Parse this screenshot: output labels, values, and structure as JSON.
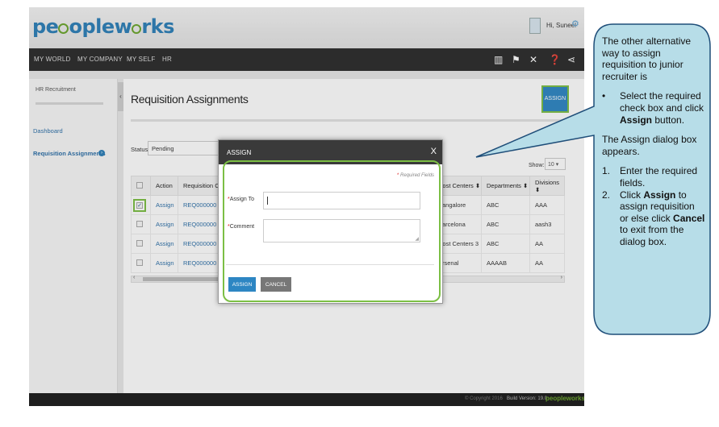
{
  "app": {
    "logo_text_a": "pe",
    "logo_text_b": "oplew",
    "logo_text_c": "rks",
    "greeting": "Hi, Suneel"
  },
  "nav": {
    "items": [
      "MY WORLD",
      "MY COMPANY",
      "MY SELF",
      "HR"
    ],
    "icons": [
      "book-icon",
      "flag-icon",
      "tools-icon",
      "help-icon",
      "share-icon"
    ]
  },
  "sidebar": {
    "section_title": "HR Recruitment",
    "items": [
      "Dashboard",
      "Requisition Assignments"
    ]
  },
  "main": {
    "page_title": "Requisition Assignments",
    "assign_button_top": "ASSIGN",
    "status_label": "Status",
    "status_value": "Pending",
    "show_label": "Show:",
    "show_value": "10",
    "columns": [
      "",
      "Action",
      "Requisition C",
      "Cost Centers",
      "Departments",
      "Divisions"
    ],
    "rows": [
      {
        "checked": true,
        "action": "Assign",
        "req": "REQ000000",
        "cost": "Bangalore",
        "dept": "ABC",
        "div": "AAA"
      },
      {
        "checked": false,
        "action": "Assign",
        "req": "REQ000000",
        "cost": "Barcelona",
        "dept": "ABC",
        "div": "aash3"
      },
      {
        "checked": false,
        "action": "Assign",
        "req": "REQ000000",
        "cost": "Cost Centers 3",
        "dept": "ABC",
        "div": "AA"
      },
      {
        "checked": false,
        "action": "Assign",
        "req": "REQ000000",
        "cost": "Arsenal",
        "dept": "AAAAB",
        "div": "AA"
      }
    ]
  },
  "dialog": {
    "title": "ASSIGN",
    "close": "X",
    "required_note": "Required Fields",
    "assign_to_label": "Assign To",
    "assign_to_value": "",
    "comment_label": "Comment",
    "comment_value": "",
    "assign_button": "ASSIGN",
    "cancel_button": "CANCEL"
  },
  "footer": {
    "copyright": "© Copyright 2016",
    "build": "Build Version: 19.0",
    "logo": "peopleworks"
  },
  "callout": {
    "intro": "The other alternative way to assign requisition to junior recruiter is",
    "bullet": "Select the required check box and click ",
    "bullet_bold": "Assign",
    "bullet_tail": " button.",
    "dialog_note": "The Assign dialog box appears.",
    "step1": "Enter the required fields.",
    "step2_a": "Click ",
    "step2_bold1": "Assign",
    "step2_b": " to assign requisition or else click ",
    "step2_bold2": "Cancel",
    "step2_c": " to exit from the dialog box.",
    "fill_color": "#b7dde8",
    "border_color": "#1f4e79"
  },
  "colors": {
    "accent_blue": "#2d86c3",
    "highlight_green": "#7cbf44",
    "nav_dark": "#2b2b2b"
  }
}
